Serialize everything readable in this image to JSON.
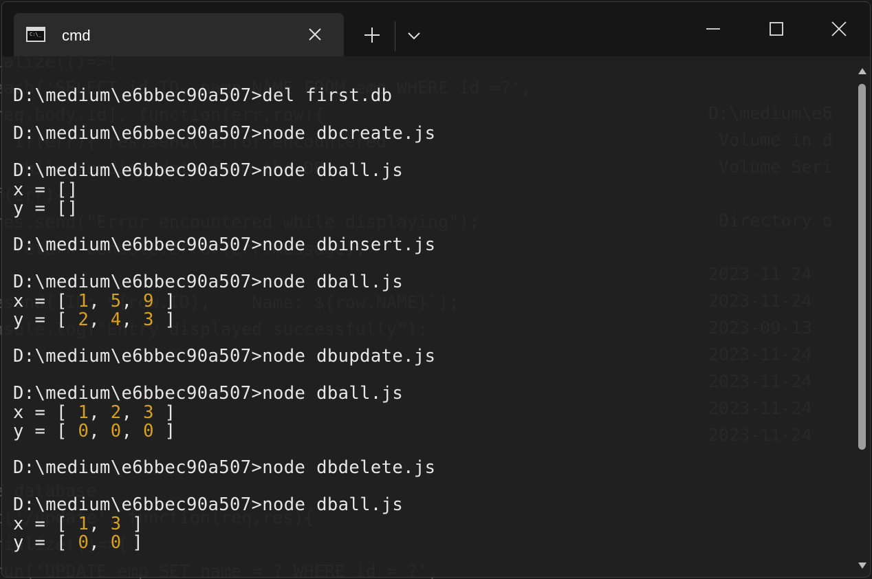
{
  "window": {
    "tab_title": "cmd",
    "tab_icon": "command-prompt-icon",
    "tab_icon_text": "C:\\_"
  },
  "terminal": {
    "lines": [
      {
        "prompt": "D:\\medium\\e6bbec90a507>del first.db"
      },
      {
        "prompt": "D:\\medium\\e6bbec90a507>node dbcreate.js"
      },
      {
        "prompt": "D:\\medium\\e6bbec90a507>node dball.js"
      },
      {
        "label": "x = []"
      },
      {
        "label": "y = []"
      },
      {
        "prompt": "D:\\medium\\e6bbec90a507>node dbinsert.js"
      },
      {
        "prompt": "D:\\medium\\e6bbec90a507>node dball.js"
      },
      {
        "array_label": "x = [",
        "values": [
          "1",
          "5",
          "9"
        ],
        "close": "]"
      },
      {
        "array_label": "y = [",
        "values": [
          "2",
          "4",
          "3"
        ],
        "close": "]"
      },
      {
        "prompt": "D:\\medium\\e6bbec90a507>node dbupdate.js"
      },
      {
        "prompt": "D:\\medium\\e6bbec90a507>node dball.js"
      },
      {
        "array_label": "x = [",
        "values": [
          "1",
          "2",
          "3"
        ],
        "close": "]"
      },
      {
        "array_label": "y = [",
        "values": [
          "0",
          "0",
          "0"
        ],
        "close": "]"
      },
      {
        "prompt": "D:\\medium\\e6bbec90a507>node dbdelete.js"
      },
      {
        "prompt": "D:\\medium\\e6bbec90a507>node dball.js"
      },
      {
        "array_label": "x = [",
        "values": [
          "1",
          "3"
        ],
        "close": "]"
      },
      {
        "array_label": "y = [",
        "values": [
          "0",
          "0"
        ],
        "close": "]"
      }
    ]
  },
  "background": {
    "left_code": [
      "ialize(()=>{",
      "each('SELECT id ID, name NAME FROM emp WHERE id =?',",
      "req.body.id], function(err,row){",
      "  if(err){ res.send(\"Error encountered\"",
      "  while reading data from the DB",
      "f(err){",
      "res.send(\"Error encountered while displaying\");",
      "  return console.error(err.message);",
      "esend(`ID: ${row.ID},    Name: ${row.NAME}`);",
      "nsole.log(\"Entry displayed successfully\");",
      "e database",
      "t('/update', function(req,res){",
      "rialize(()=>{",
      "run('UPDATE emp SET name = ? WHERE id = ?',"
    ],
    "right_lines": [
      "D:\\medium\\e6",
      " Volume in d",
      " Volume Seri",
      "",
      " Directory o",
      "",
      "2023-11-24",
      "2023-11-24",
      "2023-09-13",
      "2023-11-24",
      "2023-11-24",
      "2023-11-24",
      "2023-11-24"
    ]
  },
  "colors": {
    "number": "#d7a21a",
    "text": "#e6e6e6",
    "background": "#1b1b1b"
  }
}
